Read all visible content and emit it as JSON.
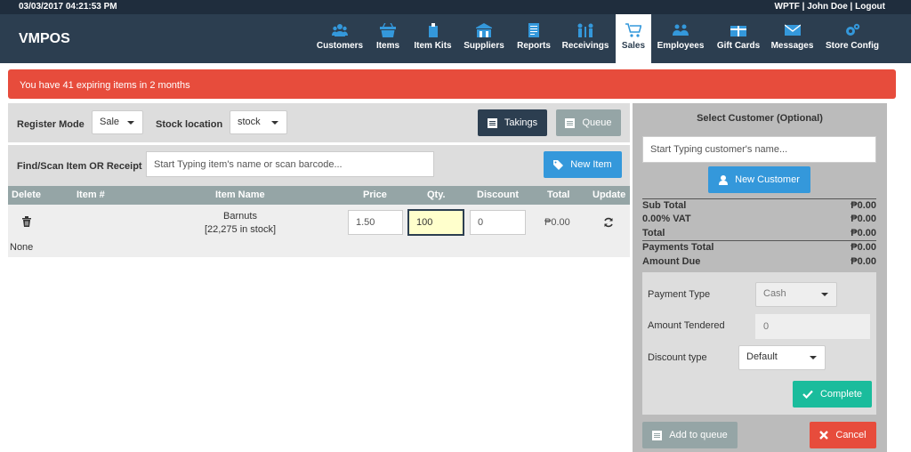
{
  "topbar": {
    "datetime": "03/03/2017 04:21:53 PM",
    "user": "WPTF | John Doe | Logout"
  },
  "brand": "VMPOS",
  "nav": [
    {
      "label": "Customers",
      "icon": "users-icon"
    },
    {
      "label": "Items",
      "icon": "basket-icon"
    },
    {
      "label": "Item Kits",
      "icon": "item-kits-icon"
    },
    {
      "label": "Suppliers",
      "icon": "suppliers-icon"
    },
    {
      "label": "Reports",
      "icon": "reports-icon"
    },
    {
      "label": "Receivings",
      "icon": "receivings-icon"
    },
    {
      "label": "Sales",
      "icon": "cart-icon",
      "active": true
    },
    {
      "label": "Employees",
      "icon": "employees-icon"
    },
    {
      "label": "Gift Cards",
      "icon": "gift-card-icon"
    },
    {
      "label": "Messages",
      "icon": "envelope-icon"
    },
    {
      "label": "Store Config",
      "icon": "gears-icon"
    }
  ],
  "alert": "You have 41 expiring items in 2 months",
  "register": {
    "mode_label": "Register Mode",
    "mode_value": "Sale",
    "stock_label": "Stock location",
    "stock_value": "stock",
    "takings_label": "Takings",
    "queue_label": "Queue"
  },
  "find": {
    "label": "Find/Scan Item OR Receipt",
    "placeholder": "Start Typing item's name or scan barcode...",
    "new_item_label": "New Item"
  },
  "table": {
    "headers": {
      "delete": "Delete",
      "item_num": "Item #",
      "item_name": "Item Name",
      "price": "Price",
      "qty": "Qty.",
      "discount": "Discount",
      "total": "Total",
      "update": "Update"
    },
    "row": {
      "name": "Barnuts",
      "stock": "[22,275 in stock]",
      "price": "1.50",
      "qty": "100",
      "discount": "0",
      "total": "₱0.00"
    },
    "serial_text": "None"
  },
  "customer": {
    "title": "Select Customer (Optional)",
    "placeholder": "Start Typing customer's name...",
    "new_customer_label": "New Customer"
  },
  "summary": [
    {
      "label": "Sub Total",
      "value": "₱0.00"
    },
    {
      "label": "0.00% VAT",
      "value": "₱0.00"
    },
    {
      "label": "Total",
      "value": "₱0.00"
    },
    {
      "label": "Payments Total",
      "value": "₱0.00"
    },
    {
      "label": "Amount Due",
      "value": "₱0.00"
    }
  ],
  "payment": {
    "type_label": "Payment Type",
    "type_value": "Cash",
    "tendered_label": "Amount Tendered",
    "tendered_value": "0",
    "discount_label": "Discount type",
    "discount_value": "Default",
    "complete_label": "Complete"
  },
  "actions": {
    "add_queue_label": "Add to queue",
    "cancel_label": "Cancel"
  },
  "colors": {
    "nav_bg": "#2c3e50",
    "accent": "#3498db",
    "alert": "#e74c3c",
    "success": "#1abc9c",
    "danger": "#e74c3c"
  }
}
